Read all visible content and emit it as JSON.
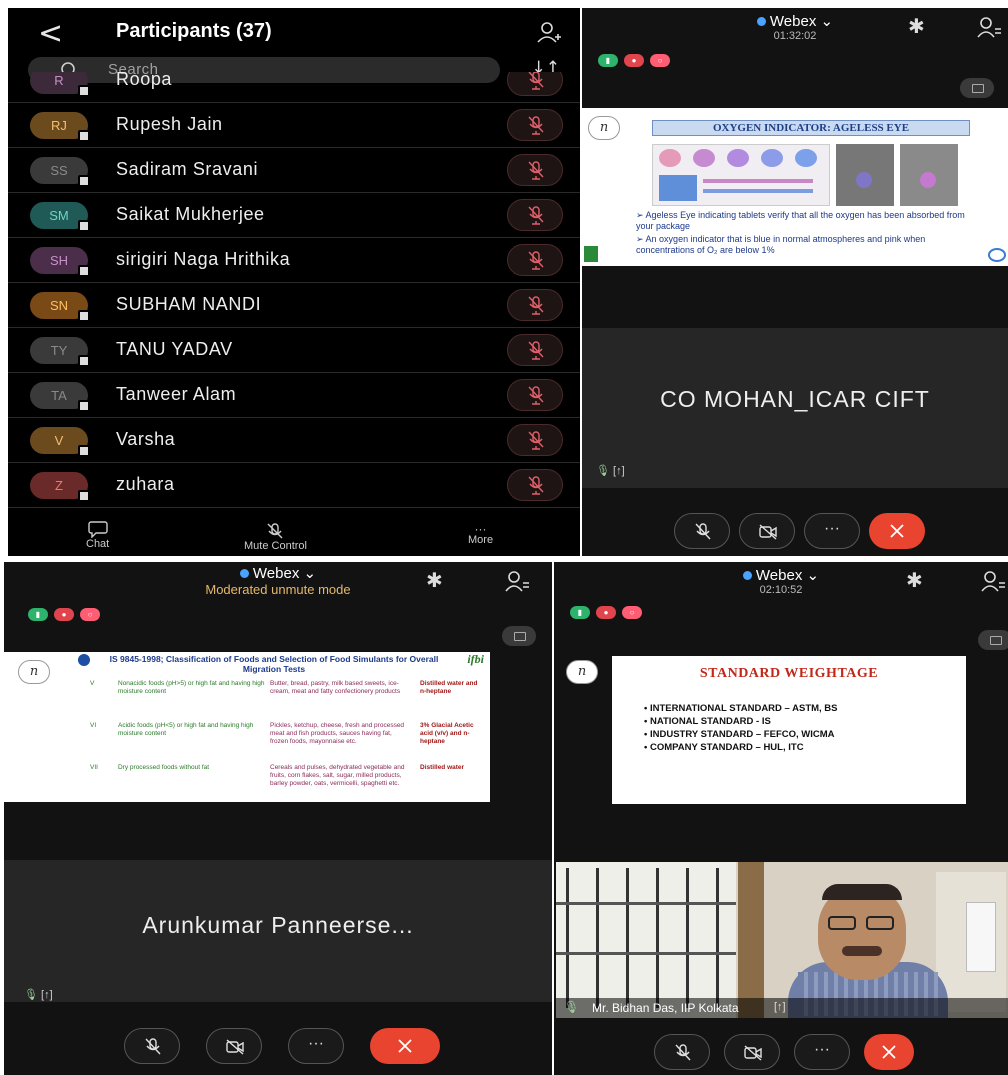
{
  "participants": {
    "back_icon": "chevron-left-icon",
    "title": "Participants (37)",
    "search_placeholder": "Search",
    "sort_glyph": "↓↑",
    "rows": [
      {
        "initials": "R",
        "name": "Roopa",
        "avatar_color": "#3c2a3a",
        "initials_color": "#c58fc4"
      },
      {
        "initials": "RJ",
        "name": "Rupesh Jain",
        "avatar_color": "#6b4a1e",
        "initials_color": "#f0c070"
      },
      {
        "initials": "SS",
        "name": "Sadiram Sravani",
        "avatar_color": "#3a3a3a",
        "initials_color": "#8a8a8a"
      },
      {
        "initials": "SM",
        "name": "Saikat Mukherjee",
        "avatar_color": "#1f5a56",
        "initials_color": "#6fd3c8"
      },
      {
        "initials": "SH",
        "name": "sirigiri Naga Hrithika",
        "avatar_color": "#4a2e4a",
        "initials_color": "#c990c9"
      },
      {
        "initials": "SN",
        "name": "SUBHAM NANDI",
        "avatar_color": "#7a4a16",
        "initials_color": "#ffc060"
      },
      {
        "initials": "TY",
        "name": "TANU YADAV",
        "avatar_color": "#3a3a3a",
        "initials_color": "#8a8a8a"
      },
      {
        "initials": "TA",
        "name": "Tanweer Alam",
        "avatar_color": "#3a3a3a",
        "initials_color": "#8a8a8a"
      },
      {
        "initials": "V",
        "name": "Varsha",
        "avatar_color": "#6b4a1e",
        "initials_color": "#f0c070"
      },
      {
        "initials": "Z",
        "name": "zuhara",
        "avatar_color": "#6a2a2a",
        "initials_color": "#f07a6a"
      }
    ],
    "footer": {
      "chat": "Chat",
      "mute_control": "Mute Control",
      "more": "More",
      "more_glyph": "···"
    }
  },
  "meeting1": {
    "app": "Webex",
    "time": "01:32:02",
    "slide": {
      "title": "OXYGEN INDICATOR: AGELESS EYE",
      "bullets": [
        "Ageless Eye indicating tablets verify that all the oxygen has been absorbed from your package",
        "An oxygen indicator that is blue in normal atmospheres and pink when concentrations of O₂ are below 1%"
      ]
    },
    "video_name": "CO MOHAN_ICAR CIFT"
  },
  "meeting2": {
    "app": "Webex",
    "mode": "Moderated unmute mode",
    "slide": {
      "title": "IS 9845-1998; Classification of Foods and Selection of Food Simulants for Overall Migration Tests",
      "logo": "ifbi",
      "rows": [
        {
          "num": "V",
          "food": "Nonacidic foods (pH>5) or high fat and having high moisture content",
          "examples": "Butter, bread, pastry, milk based sweets, ice-cream, meat and fatty confectionery products",
          "simulant": "Distilled water and n-heptane"
        },
        {
          "num": "VI",
          "food": "Acidic foods (pH<5) or high fat and having high moisture content",
          "examples": "Pickles, ketchup, cheese, fresh and processed meat and fish products, sauces having fat, frozen foods, mayonnaise etc.",
          "simulant": "3% Glacial Acetic acid (v/v) and n-heptane"
        },
        {
          "num": "VII",
          "food": "Dry processed foods without fat",
          "examples": "Cereals and pulses, dehydrated vegetable and fruits, corn flakes, salt, sugar, milled products, barley powder, oats, vermicelli, spaghetti etc.",
          "simulant": "Distilled water"
        }
      ]
    },
    "video_name": "Arunkumar Panneerse..."
  },
  "meeting3": {
    "app": "Webex",
    "time": "02:10:52",
    "slide": {
      "title": "STANDARD WEIGHTAGE",
      "bullets": [
        "INTERNATIONAL STANDARD – ASTM, BS",
        "NATIONAL STANDARD - IS",
        "INDUSTRY STANDARD – FEFCO, WICMA",
        "COMPANY STANDARD – HUL, ITC"
      ]
    },
    "speaker_label": "Mr. Bidhan Das, IIP Kolkata"
  },
  "colors": {
    "end_call": "#e9442f",
    "accent_blue": "#4aa3ff",
    "mode_text": "#e6b86a"
  }
}
